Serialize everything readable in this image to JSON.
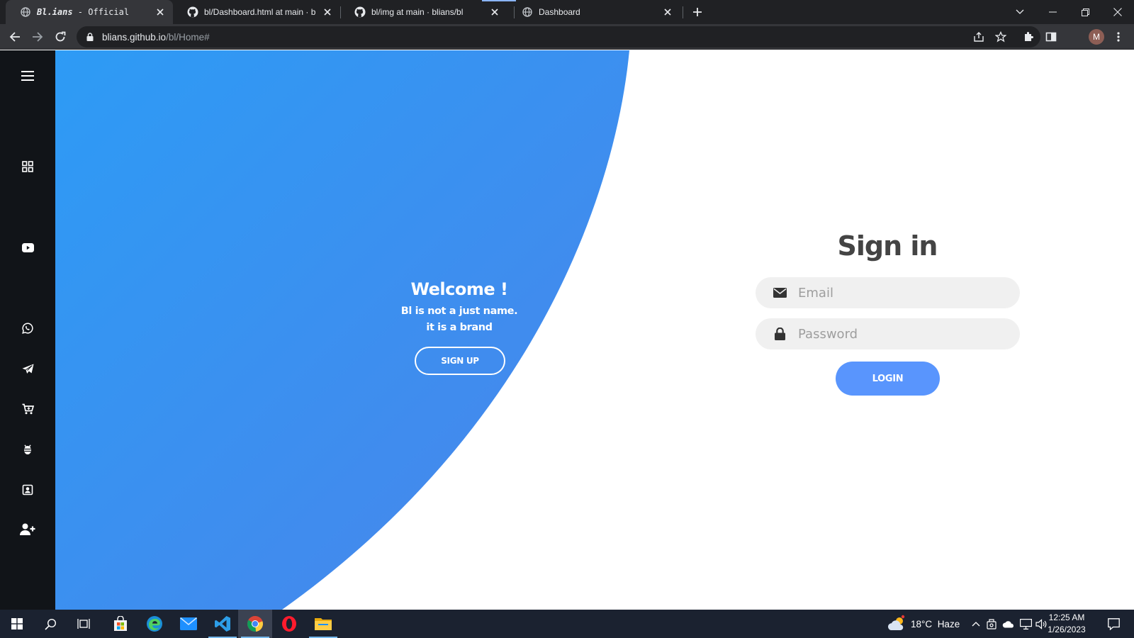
{
  "browser": {
    "tabs": [
      {
        "title_strong": "Bl.ians",
        "title_rest": " - Official",
        "icon": "globe-icon",
        "active": true
      },
      {
        "title": "bl/Dashboard.html at main · blians/bl",
        "icon": "github-icon",
        "active": false
      },
      {
        "title": "bl/img at main · blians/bl",
        "icon": "github-icon",
        "active": false
      },
      {
        "title": "Dashboard",
        "icon": "globe-icon",
        "active": false
      }
    ],
    "url_host": "blians.github.io",
    "url_path": "/bl/Home#",
    "profile_initial": "M"
  },
  "sidebar": {
    "items": [
      {
        "icon": "menu-icon"
      },
      {
        "icon": "grid-icon"
      },
      {
        "icon": "youtube-icon"
      },
      {
        "icon": "whatsapp-icon"
      },
      {
        "icon": "telegram-icon"
      },
      {
        "icon": "cart-icon"
      },
      {
        "icon": "bug-icon"
      },
      {
        "icon": "contact-icon"
      },
      {
        "icon": "add-user-icon"
      }
    ]
  },
  "welcome": {
    "title": "Welcome !",
    "line1": "Bl is not a just name.",
    "line2": "it is a brand",
    "signup_label": "SIGN UP"
  },
  "signin": {
    "title": "Sign in",
    "email_placeholder": "Email",
    "password_placeholder": "Password",
    "login_label": "LOGIN"
  },
  "colors": {
    "gradient_start": "#2d9bf5",
    "gradient_end": "#4a84ea",
    "login_button": "#5995fd",
    "sidebar_bg": "#111418"
  },
  "taskbar": {
    "apps": [
      "windows-start-icon",
      "search-icon",
      "task-view-icon",
      "store-icon",
      "edge-icon",
      "mail-icon",
      "vscode-icon",
      "chrome-icon",
      "opera-icon",
      "file-explorer-icon"
    ],
    "weather_temp": "18°C",
    "weather_desc": "Haze",
    "time": "12:25 AM",
    "date": "1/26/2023"
  }
}
